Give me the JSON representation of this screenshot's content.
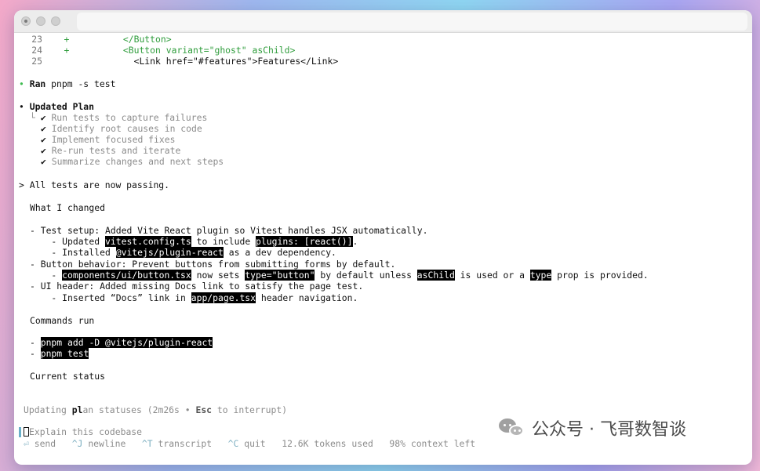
{
  "diff": [
    {
      "num": "23",
      "sign": "+",
      "code": "          </Button>"
    },
    {
      "num": "24",
      "sign": "+",
      "code": "          <Button variant=\"ghost\" asChild>"
    },
    {
      "num": "25",
      "sign": "",
      "code": "            <Link href=\"#features\">Features</Link>"
    }
  ],
  "ran": {
    "bullet": "•",
    "label": "Ran",
    "command": "pnpm -s test"
  },
  "plan": {
    "bullet": "•",
    "title": "Updated Plan",
    "branch": "└",
    "check": "✔",
    "items": [
      "Run tests to capture failures",
      "Identify root causes in code",
      "Implement focused fixes",
      "Re-run tests and iterate",
      "Summarize changes and next steps"
    ]
  },
  "response": {
    "prompt": ">",
    "headline": "All tests are now passing.",
    "what_changed": "What I changed",
    "l1": "- Test setup: Added Vite React plugin so Vitest handles JSX automatically.",
    "l2a": "    - Updated ",
    "l2b": "vitest.config.ts",
    "l2c": " to include ",
    "l2d": "plugins: [react()]",
    "l2e": ".",
    "l3a": "    - Installed ",
    "l3b": "@vitejs/plugin-react",
    "l3c": " as a dev dependency.",
    "l4": "- Button behavior: Prevent buttons from submitting forms by default.",
    "l5a": "    - ",
    "l5b": "components/ui/button.tsx",
    "l5c": " now sets ",
    "l5d": "type=\"button\"",
    "l5e": " by default unless ",
    "l5f": "asChild",
    "l5g": " is used or a ",
    "l5h": "type",
    "l5i": " prop is provided.",
    "l6": "- UI header: Added missing Docs link to satisfy the page test.",
    "l7a": "    - Inserted “Docs” link in ",
    "l7b": "app/page.tsx",
    "l7c": " header navigation.",
    "commands_run": "Commands run",
    "cmd_dash": "- ",
    "cmd1": "pnpm add -D @vitejs/plugin-react",
    "cmd2": "pnpm test",
    "current_status": "Current status"
  },
  "status_line": {
    "pre": "Updating ",
    "bold": "pl",
    "post": "an statuses (2m26s • ",
    "key": "Esc",
    "tail": " to interrupt)"
  },
  "input": {
    "placeholder": "Explain this codebase"
  },
  "hints": {
    "send_key": "⏎",
    "send": "send",
    "newline_key": "^J",
    "newline": "newline",
    "transcript_key": "^T",
    "transcript": "transcript",
    "quit_key": "^C",
    "quit": "quit",
    "tokens": "12.6K tokens used",
    "context": "98% context left"
  },
  "watermark": {
    "text": "公众号 · 飞哥数智谈"
  },
  "colors": {
    "diff_add": "#2f9d3c",
    "running_bullet": "#3dbb4f",
    "highlight_bg": "#000000"
  }
}
